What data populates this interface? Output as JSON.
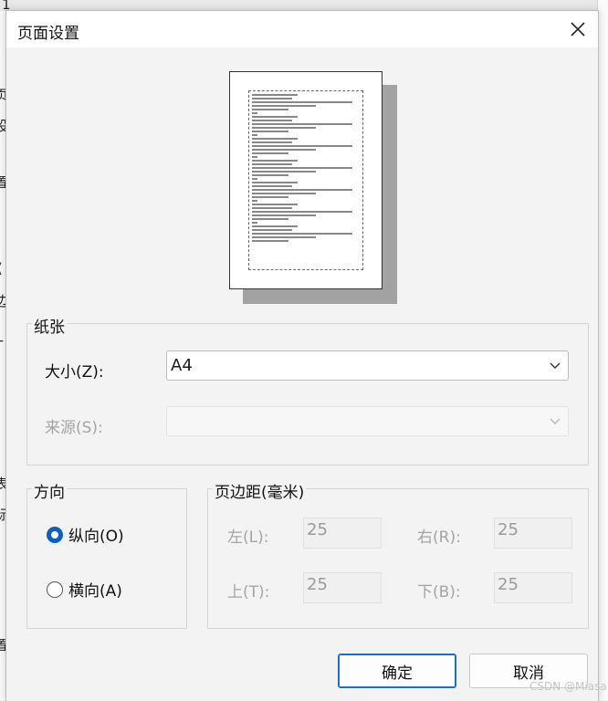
{
  "background": {
    "glyphs": [
      "1",
      "页",
      "设",
      "置",
      "(",
      "边",
      "T",
      "表",
      "标",
      "置"
    ]
  },
  "dialog": {
    "title": "页面设置",
    "paper_section": {
      "legend": "纸张",
      "size_label": "大小(Z):",
      "size_value": "A4",
      "source_label": "来源(S):",
      "source_value": ""
    },
    "orientation_section": {
      "legend": "方向",
      "portrait_label": "纵向(O)",
      "landscape_label": "横向(A)",
      "selected": "portrait"
    },
    "margins_section": {
      "legend": "页边距(毫米)",
      "left_label": "左(L):",
      "left_value": "25",
      "right_label": "右(R):",
      "right_value": "25",
      "top_label": "上(T):",
      "top_value": "25",
      "bottom_label": "下(B):",
      "bottom_value": "25"
    },
    "ok_label": "确定",
    "cancel_label": "取消"
  },
  "watermark": "CSDN @Miasa",
  "colors": {
    "accent": "#0a5ec7",
    "disabled_text": "#a4a4a4",
    "dialog_bg": "#f3f3f3"
  }
}
